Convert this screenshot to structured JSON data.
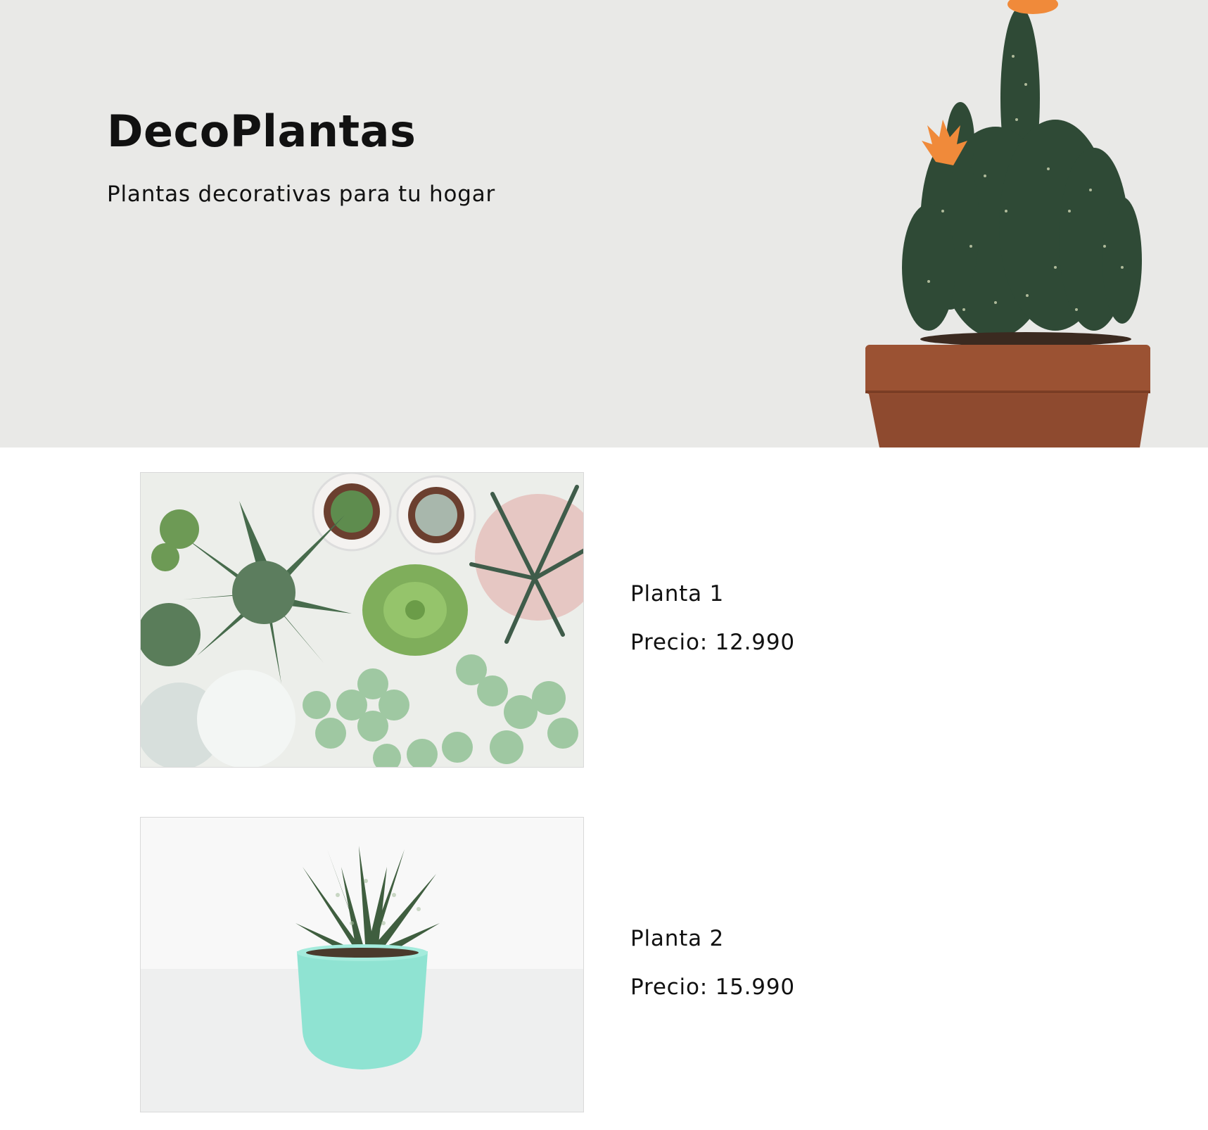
{
  "hero": {
    "title": "DecoPlantas",
    "subtitle": "Plantas decorativas para tu hogar",
    "image_icon": "cactus-in-pot-image"
  },
  "products": [
    {
      "name": "Planta 1",
      "price": "Precio: 12.990",
      "image_icon": "succulent-assortment-image"
    },
    {
      "name": "Planta 2",
      "price": "Precio: 15.990",
      "image_icon": "potted-haworthia-image"
    }
  ],
  "colors": {
    "hero_bg": "#e9e9e7",
    "pot": "#8e4a2f",
    "cactus": "#2f4a36",
    "flower": "#f08a3a",
    "mint_pot": "#8fe3d2"
  }
}
